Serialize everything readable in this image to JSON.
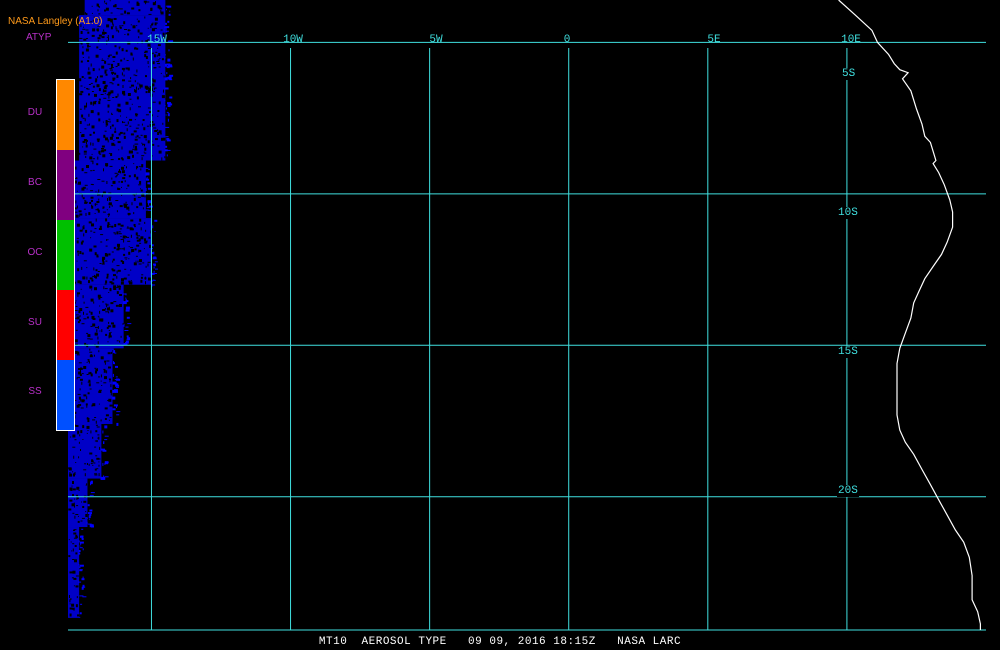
{
  "header": {
    "source": "NASA Langley (A1.0)",
    "product": "ATYP"
  },
  "legend": {
    "items": [
      {
        "label": "DU",
        "color": "#ff8800"
      },
      {
        "label": "BC",
        "color": "#800080"
      },
      {
        "label": "OC",
        "color": "#00c000"
      },
      {
        "label": "SU",
        "color": "#ff0000"
      },
      {
        "label": "SS",
        "color": "#0050ff"
      }
    ]
  },
  "grid": {
    "longitude_labels": [
      {
        "label": "15W",
        "lon": -15
      },
      {
        "label": "10W",
        "lon": -10
      },
      {
        "label": "5W",
        "lon": -5
      },
      {
        "label": "0",
        "lon": 0
      },
      {
        "label": "5E",
        "lon": 5
      },
      {
        "label": "10E",
        "lon": 10
      }
    ],
    "latitude_labels": [
      {
        "label": "5S",
        "lat": -5
      },
      {
        "label": "10S",
        "lat": -10
      },
      {
        "label": "15S",
        "lat": -15
      },
      {
        "label": "20S",
        "lat": -20
      }
    ],
    "line_color": "#40e0e0"
  },
  "map": {
    "extent": {
      "lon_min": -18,
      "lon_max": 15,
      "lat_min": -24.4,
      "lat_max": -3.6
    },
    "coastline_color": "#ffffff",
    "data_color": "#0000ff",
    "coastline": [
      [
        9.7,
        -3.6
      ],
      [
        10.3,
        -4.1
      ],
      [
        10.9,
        -4.6
      ],
      [
        11.1,
        -5.0
      ],
      [
        11.5,
        -5.4
      ],
      [
        11.7,
        -5.7
      ],
      [
        11.9,
        -5.9
      ],
      [
        12.2,
        -6.0
      ],
      [
        12.0,
        -6.2
      ],
      [
        12.3,
        -6.6
      ],
      [
        12.5,
        -7.2
      ],
      [
        12.7,
        -7.7
      ],
      [
        12.8,
        -8.1
      ],
      [
        13.0,
        -8.3
      ],
      [
        13.2,
        -8.9
      ],
      [
        13.1,
        -9.0
      ],
      [
        13.3,
        -9.3
      ],
      [
        13.5,
        -9.7
      ],
      [
        13.7,
        -10.2
      ],
      [
        13.8,
        -10.6
      ],
      [
        13.8,
        -11.1
      ],
      [
        13.6,
        -11.6
      ],
      [
        13.4,
        -12.0
      ],
      [
        13.1,
        -12.4
      ],
      [
        12.8,
        -12.8
      ],
      [
        12.6,
        -13.2
      ],
      [
        12.4,
        -13.6
      ],
      [
        12.3,
        -14.1
      ],
      [
        12.1,
        -14.6
      ],
      [
        11.9,
        -15.1
      ],
      [
        11.8,
        -15.6
      ],
      [
        11.8,
        -16.1
      ],
      [
        11.8,
        -16.8
      ],
      [
        11.8,
        -17.3
      ],
      [
        11.9,
        -17.8
      ],
      [
        12.1,
        -18.2
      ],
      [
        12.4,
        -18.6
      ],
      [
        12.7,
        -19.1
      ],
      [
        13.0,
        -19.6
      ],
      [
        13.3,
        -20.1
      ],
      [
        13.6,
        -20.6
      ],
      [
        13.9,
        -21.1
      ],
      [
        14.2,
        -21.5
      ],
      [
        14.4,
        -22.0
      ],
      [
        14.5,
        -22.6
      ],
      [
        14.5,
        -23.0
      ],
      [
        14.5,
        -23.4
      ],
      [
        14.7,
        -23.8
      ],
      [
        14.8,
        -24.2
      ],
      [
        14.8,
        -24.4
      ]
    ],
    "swath": [
      {
        "lon_min": -17.4,
        "lon_max": -14.5,
        "lat_min": -4.1,
        "lat_max": -3.6
      },
      {
        "lon_min": -17.6,
        "lon_max": -14.5,
        "lat_min": -8.9,
        "lat_max": -4.1
      },
      {
        "lon_min": -17.8,
        "lon_max": -15.2,
        "lat_min": -10.8,
        "lat_max": -8.9
      },
      {
        "lon_min": -17.8,
        "lon_max": -15.0,
        "lat_min": -13.0,
        "lat_max": -10.8
      },
      {
        "lon_min": -17.8,
        "lon_max": -16.0,
        "lat_min": -15.1,
        "lat_max": -13.0
      },
      {
        "lon_min": -18.0,
        "lon_max": -16.4,
        "lat_min": -17.6,
        "lat_max": -15.1
      },
      {
        "lon_min": -18.0,
        "lon_max": -16.8,
        "lat_min": -19.4,
        "lat_max": -17.6
      },
      {
        "lon_min": -18.0,
        "lon_max": -17.3,
        "lat_min": -21.0,
        "lat_max": -19.4
      },
      {
        "lon_min": -18.0,
        "lon_max": -17.6,
        "lat_min": -24.0,
        "lat_max": -21.0
      }
    ]
  },
  "footer": {
    "caption": "MT10  AEROSOL TYPE   09 09, 2016 18:15Z   NASA LARC"
  }
}
